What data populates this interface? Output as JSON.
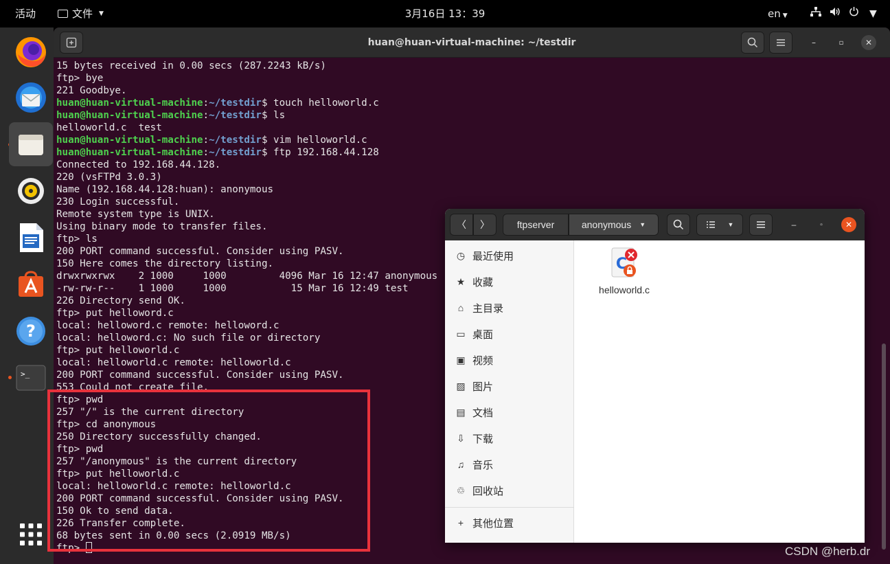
{
  "topbar": {
    "activities": "活动",
    "files_menu": "文件",
    "clock": "3月16日  13：39",
    "lang": "en"
  },
  "dock": {
    "apps": [
      "firefox",
      "thunderbird",
      "files",
      "rhythmbox",
      "libreoffice-writer",
      "software-center",
      "help",
      "terminal",
      "show-apps"
    ]
  },
  "terminal": {
    "title": "huan@huan-virtual-machine: ~/testdir",
    "prompt_user": "huan@huan-virtual-machine",
    "prompt_path": "~/testdir",
    "lines": [
      {
        "t": "15 bytes received in 0.00 secs (287.2243 kB/s)"
      },
      {
        "t": "ftp> bye"
      },
      {
        "t": "221 Goodbye."
      },
      {
        "p": true,
        "cmd": "touch helloworld.c"
      },
      {
        "p": true,
        "cmd": "ls"
      },
      {
        "t": "helloworld.c  test"
      },
      {
        "p": true,
        "cmd": "vim helloworld.c"
      },
      {
        "p": true,
        "cmd": "ftp 192.168.44.128"
      },
      {
        "t": "Connected to 192.168.44.128."
      },
      {
        "t": "220 (vsFTPd 3.0.3)"
      },
      {
        "t": "Name (192.168.44.128:huan): anonymous"
      },
      {
        "t": "230 Login successful."
      },
      {
        "t": "Remote system type is UNIX."
      },
      {
        "t": "Using binary mode to transfer files."
      },
      {
        "t": "ftp> ls"
      },
      {
        "t": "200 PORT command successful. Consider using PASV."
      },
      {
        "t": "150 Here comes the directory listing."
      },
      {
        "t": "drwxrwxrwx    2 1000     1000         4096 Mar 16 12:47 anonymous"
      },
      {
        "t": "-rw-rw-r--    1 1000     1000           15 Mar 16 12:49 test"
      },
      {
        "t": "226 Directory send OK."
      },
      {
        "t": "ftp> put helloword.c"
      },
      {
        "t": "local: helloword.c remote: helloword.c"
      },
      {
        "t": "local: helloword.c: No such file or directory"
      },
      {
        "t": "ftp> put helloworld.c"
      },
      {
        "t": "local: helloworld.c remote: helloworld.c"
      },
      {
        "t": "200 PORT command successful. Consider using PASV."
      },
      {
        "t": "553 Could not create file."
      },
      {
        "t": "ftp> pwd"
      },
      {
        "t": "257 \"/\" is the current directory"
      },
      {
        "t": "ftp> cd anonymous"
      },
      {
        "t": "250 Directory successfully changed."
      },
      {
        "t": "ftp> pwd"
      },
      {
        "t": "257 \"/anonymous\" is the current directory"
      },
      {
        "t": "ftp> put helloworld.c"
      },
      {
        "t": "local: helloworld.c remote: helloworld.c"
      },
      {
        "t": "200 PORT command successful. Consider using PASV."
      },
      {
        "t": "150 Ok to send data."
      },
      {
        "t": "226 Transfer complete."
      },
      {
        "t": "68 bytes sent in 0.00 secs (2.0919 MB/s)"
      },
      {
        "t": "ftp> ",
        "cursor": true
      }
    ]
  },
  "file_manager": {
    "breadcrumb": [
      "ftpserver",
      "anonymous"
    ],
    "sidebar": [
      {
        "label": "最近使用",
        "icon": "clock-icon"
      },
      {
        "label": "收藏",
        "icon": "star-icon"
      },
      {
        "label": "主目录",
        "icon": "home-icon"
      },
      {
        "label": "桌面",
        "icon": "desktop-icon"
      },
      {
        "label": "视频",
        "icon": "video-icon"
      },
      {
        "label": "图片",
        "icon": "image-icon"
      },
      {
        "label": "文档",
        "icon": "document-icon"
      },
      {
        "label": "下载",
        "icon": "download-icon"
      },
      {
        "label": "音乐",
        "icon": "music-icon"
      },
      {
        "label": "回收站",
        "icon": "trash-icon"
      },
      {
        "label": "其他位置",
        "icon": "plus-icon"
      }
    ],
    "files": [
      {
        "name": "helloworld.c",
        "icon": "c-source-file-icon"
      }
    ]
  },
  "watermark": "CSDN @herb.dr",
  "colors": {
    "terminal_bg": "#300a24",
    "prompt_user": "#4ed14e",
    "prompt_path": "#729fcf",
    "highlight": "#e8323c",
    "accent_close": "#e95420"
  }
}
